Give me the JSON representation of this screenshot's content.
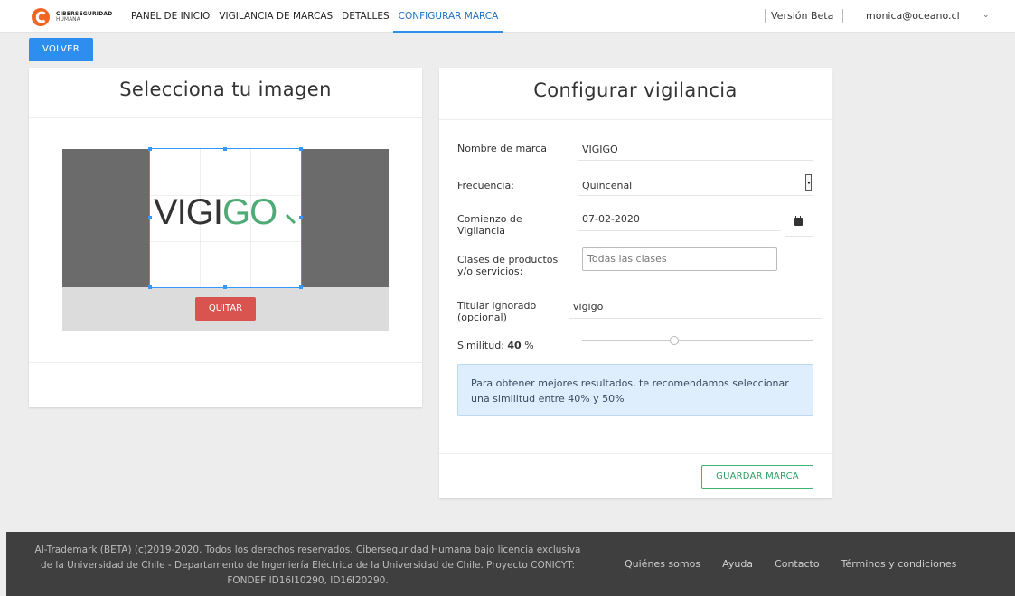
{
  "header": {
    "logo_line1": "CIBERSEGURIDAD",
    "logo_line2": "HUMANA",
    "nav": [
      {
        "label": "PANEL DE INICIO"
      },
      {
        "label": "VIGILANCIA DE MARCAS"
      },
      {
        "label": "DETALLES"
      },
      {
        "label": "CONFIGURAR MARCA",
        "active": true
      }
    ],
    "beta_label": "Versión Beta",
    "user_email": "monica@oceano.cl"
  },
  "back_button": "VOLVER",
  "image_card": {
    "title": "Selecciona tu imagen",
    "logo_text_dark": "VIGI",
    "logo_text_green": "GO",
    "remove_button": "QUITAR"
  },
  "config_card": {
    "title": "Configurar vigilancia",
    "fields": {
      "brand_name_label": "Nombre de marca",
      "brand_name_value": "VIGIGO",
      "frequency_label": "Frecuencia:",
      "frequency_value": "Quincenal",
      "start_label": "Comienzo de Vigilancia",
      "start_value": "07-02-2020",
      "classes_label": "Clases de productos y/o servicios:",
      "classes_placeholder": "Todas las clases",
      "ignored_label": "Titular ignorado (opcional)",
      "ignored_value": "vigigo",
      "similarity_label": "Similitud:",
      "similarity_value": "40",
      "similarity_unit": "%",
      "similarity_fraction": 0.4
    },
    "info_text": "Para obtener mejores resultados, te recomendamos seleccionar una similitud entre 40% y 50%",
    "save_button": "GUARDAR MARCA"
  },
  "footer": {
    "text": "AI-Trademark (BETA) (c)2019-2020. Todos los derechos reservados. Ciberseguridad Humana bajo licencia exclusiva de la Universidad de Chile - Departamento de Ingeniería Eléctrica de la Universidad de Chile. Proyecto CONICYT: FONDEF ID16I10290, ID16I20290.",
    "links": [
      "Quiénes somos",
      "Ayuda",
      "Contacto",
      "Términos y condiciones"
    ]
  },
  "colors": {
    "primary": "#2d8ef0",
    "danger": "#d9534f",
    "success": "#3cb371",
    "brand_orange": "#f26522"
  }
}
